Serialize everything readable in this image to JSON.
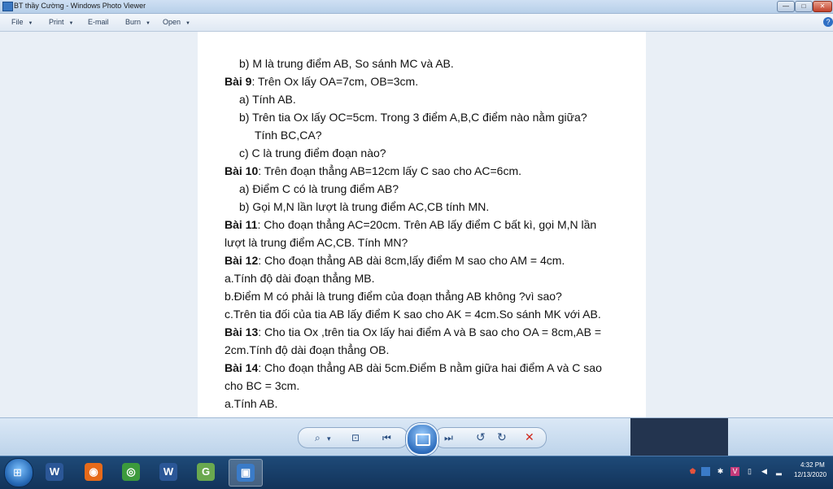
{
  "window": {
    "title": "BT thầy Cường - Windows Photo Viewer",
    "min_glyph": "—",
    "max_glyph": "□",
    "close_glyph": "✕"
  },
  "menu": {
    "file": "File",
    "print": "Print",
    "email": "E-mail",
    "burn": "Burn",
    "open": "Open",
    "dropdown_glyph": "▼",
    "help_glyph": "?"
  },
  "document": {
    "lines": [
      {
        "bold": "",
        "text": "b) M là trung điểm AB, So sánh MC và AB."
      },
      {
        "bold": "Bài 9",
        "text": ": Trên Ox lấy OA=7cm, OB=3cm."
      },
      {
        "bold": "",
        "text": "a) Tính AB."
      },
      {
        "bold": "",
        "text": "b) Trên tia Ox lấy OC=5cm. Trong 3 điểm A,B,C điểm nào nằm giữa?"
      },
      {
        "bold": "",
        "text": "Tính BC,CA?"
      },
      {
        "bold": "",
        "text": "c) C là trung điểm đoạn nào?"
      },
      {
        "bold": "Bài 10",
        "text": ": Trên đoạn thẳng AB=12cm lấy C sao cho AC=6cm."
      },
      {
        "bold": "",
        "text": "a) Điểm C có là trung điểm AB?"
      },
      {
        "bold": "",
        "text": "b) Gọi M,N lần lượt là trung điểm AC,CB tính MN."
      },
      {
        "bold": "Bài 11",
        "text": ": Cho đoạn thẳng AC=20cm. Trên AB lấy điểm C bất kì, gọi M,N lần"
      },
      {
        "bold": "",
        "text": "lượt là trung điểm AC,CB. Tính MN?"
      },
      {
        "bold": "Bài 12",
        "text": ": Cho đoạn thẳng AB dài 8cm,lấy điểm M sao cho AM = 4cm."
      },
      {
        "bold": "",
        "text": "a.Tính độ dài đoạn thẳng MB."
      },
      {
        "bold": "",
        "text": "b.Điểm M có phải là trung điểm của đoạn thẳng AB không ?vì sao?"
      },
      {
        "bold": "",
        "text": "c.Trên tia đối của tia AB lấy điểm K sao cho AK = 4cm.So sánh MK với AB."
      },
      {
        "bold": "Bài 13",
        "text": ": Cho tia Ox ,trên tia Ox lấy hai điểm A và B sao cho OA = 8cm,AB ="
      },
      {
        "bold": "",
        "text": "2cm.Tính độ dài đoạn thẳng OB."
      },
      {
        "bold": "Bài 14",
        "text": ": Cho đoạn thẳng AB dài 5cm.Điểm B nằm giữa hai điểm A và C sao"
      },
      {
        "bold": "",
        "text": "cho BC = 3cm."
      },
      {
        "bold": "",
        "text": "a.Tính AB."
      }
    ]
  },
  "controls": {
    "zoom_glyph": "⌕",
    "zoom_caret": "▾",
    "fit_glyph": "⊡",
    "prev_glyph": "⏮",
    "next_glyph": "⏭",
    "rotate_ccw_glyph": "↺",
    "rotate_cw_glyph": "↻",
    "delete_glyph": "✕",
    "colors": {
      "delete": "#d0281c",
      "accent": "#2a4f82"
    }
  },
  "taskbar": {
    "start_glyph": "⊞",
    "apps": [
      {
        "name": "word-app",
        "glyph": "W",
        "color": "#2b5797"
      },
      {
        "name": "firefox-app",
        "glyph": "◉",
        "color": "#e66a1a"
      },
      {
        "name": "chrome-app",
        "glyph": "◎",
        "color": "#3c9a3c"
      },
      {
        "name": "word-app-2",
        "glyph": "W",
        "color": "#2b5797"
      },
      {
        "name": "geogebra-app",
        "glyph": "G",
        "color": "#6aa84f"
      },
      {
        "name": "photo-viewer-app",
        "glyph": "▣",
        "color": "#3a7bc8"
      }
    ],
    "clock_time": "4:32 PM",
    "clock_date": "12/13/2020"
  }
}
